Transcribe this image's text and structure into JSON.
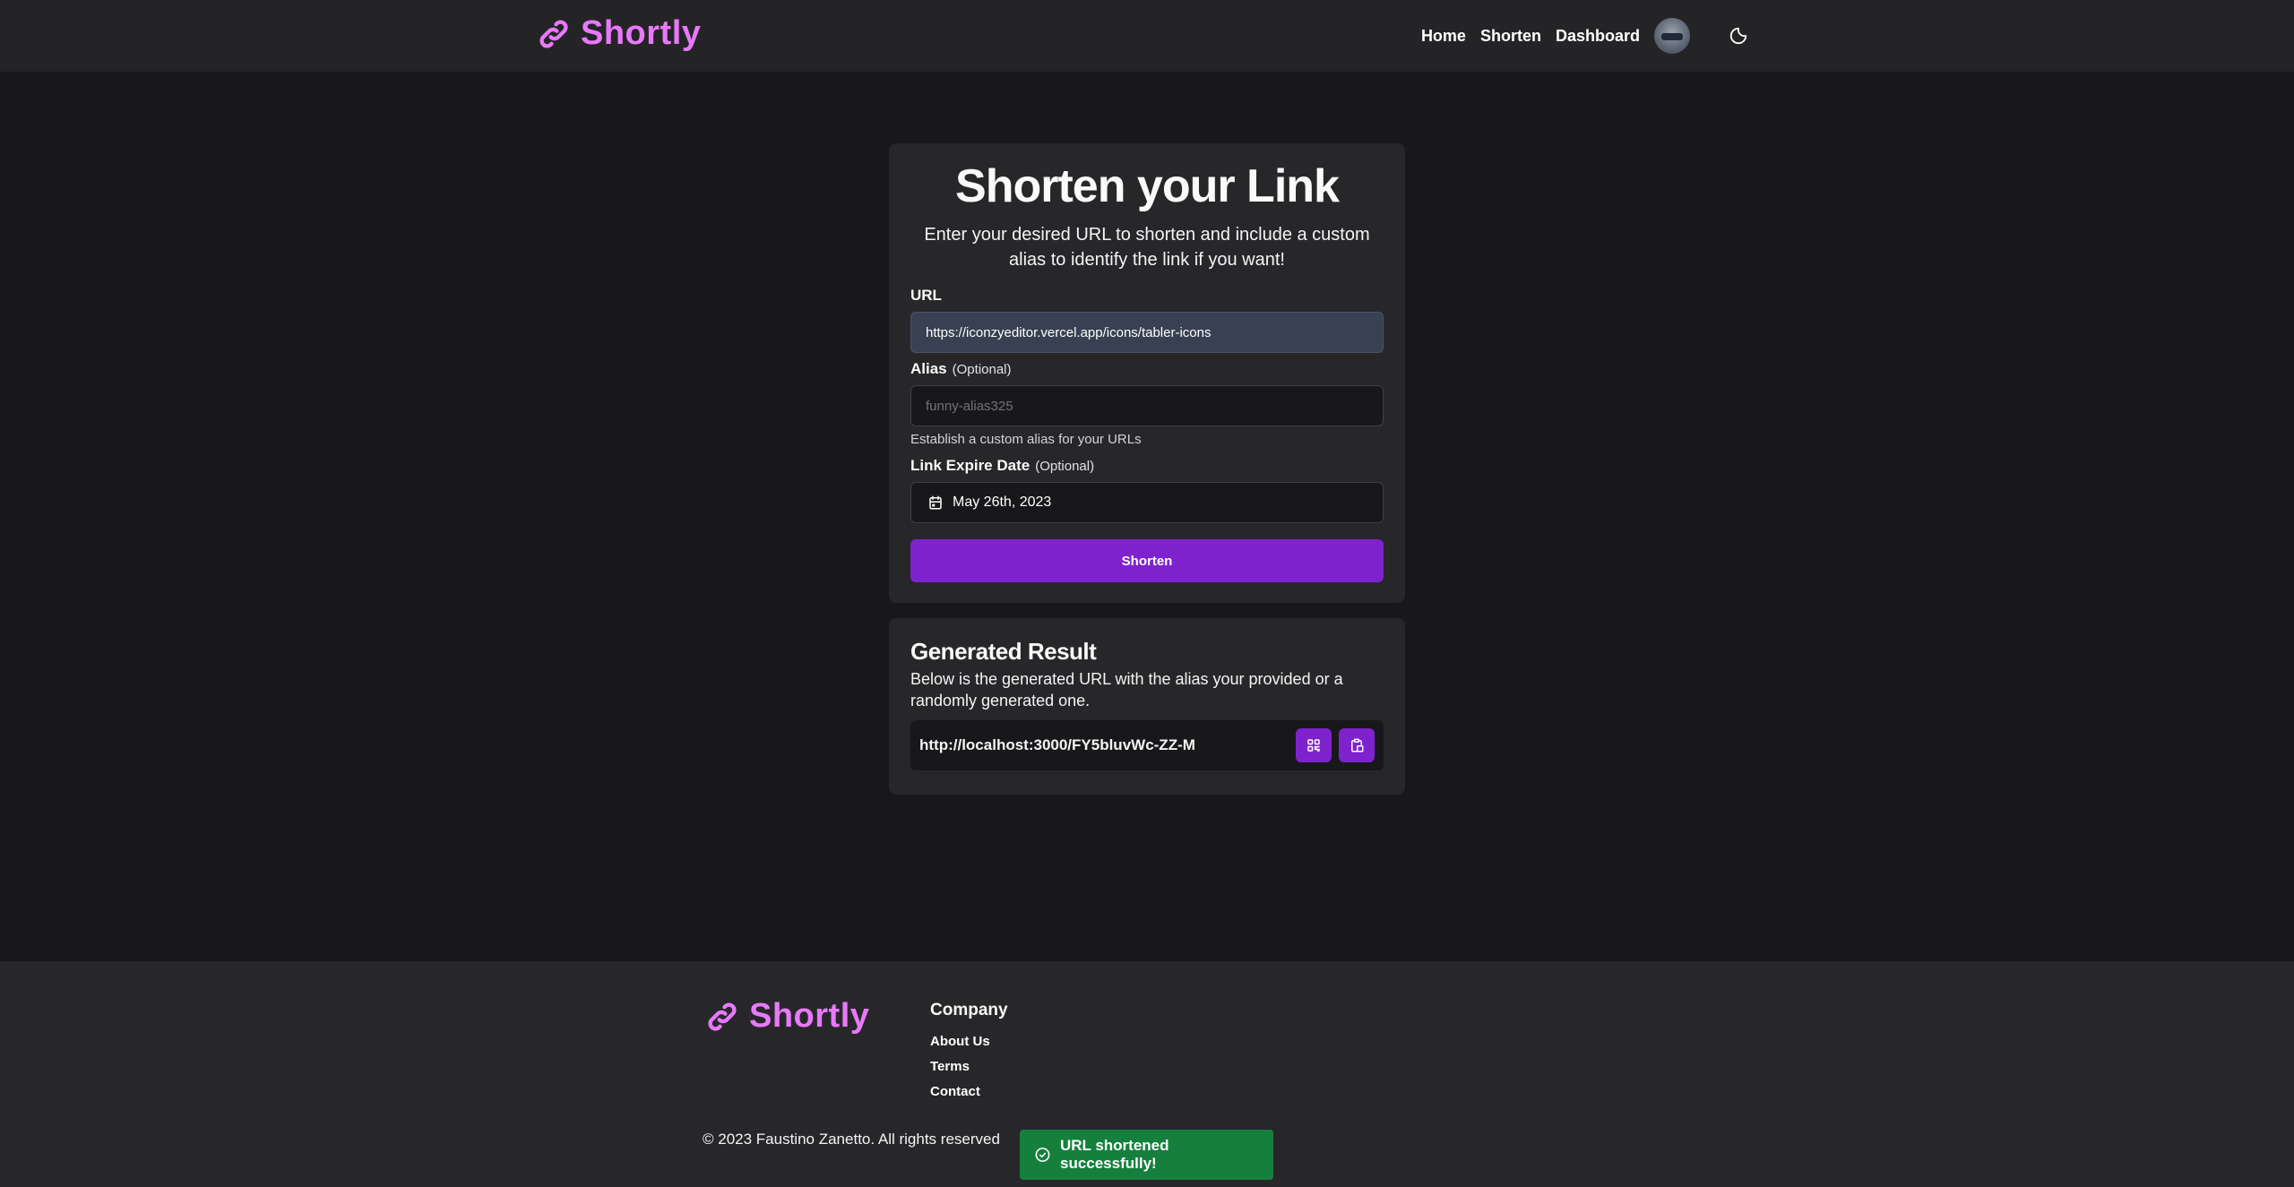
{
  "header": {
    "brand": "Shortly",
    "nav": [
      "Home",
      "Shorten",
      "Dashboard"
    ]
  },
  "form": {
    "title": "Shorten your Link",
    "description": "Enter your desired URL to shorten and include a custom alias to identify the link if you want!",
    "url_label": "URL",
    "url_value": "https://iconzyeditor.vercel.app/icons/tabler-icons",
    "alias_label": "Alias",
    "optional_text": "(Optional)",
    "alias_placeholder": "funny-alias325",
    "alias_helper": "Establish a custom alias for your URLs",
    "expire_label": "Link Expire Date",
    "expire_value": "May 26th, 2023",
    "submit_label": "Shorten"
  },
  "result": {
    "title": "Generated Result",
    "description": "Below is the generated URL with the alias your provided or a randomly generated one.",
    "url": "http://localhost:3000/FY5bluvWc-ZZ-M"
  },
  "footer": {
    "brand": "Shortly",
    "company_title": "Company",
    "links": [
      "About Us",
      "Terms",
      "Contact"
    ],
    "copyright": "© 2023 Faustino Zanetto. All rights reserved"
  },
  "toast": {
    "message": "URL shortened successfully!"
  },
  "colors": {
    "brand": "#e879f9",
    "accent": "#7e22ce",
    "success": "#15803d",
    "background": "#18181b"
  },
  "icons": [
    "link-icon",
    "avatar",
    "moon-icon",
    "calendar-icon",
    "qr-code-icon",
    "clipboard-copy-icon",
    "check-circle-icon"
  ]
}
